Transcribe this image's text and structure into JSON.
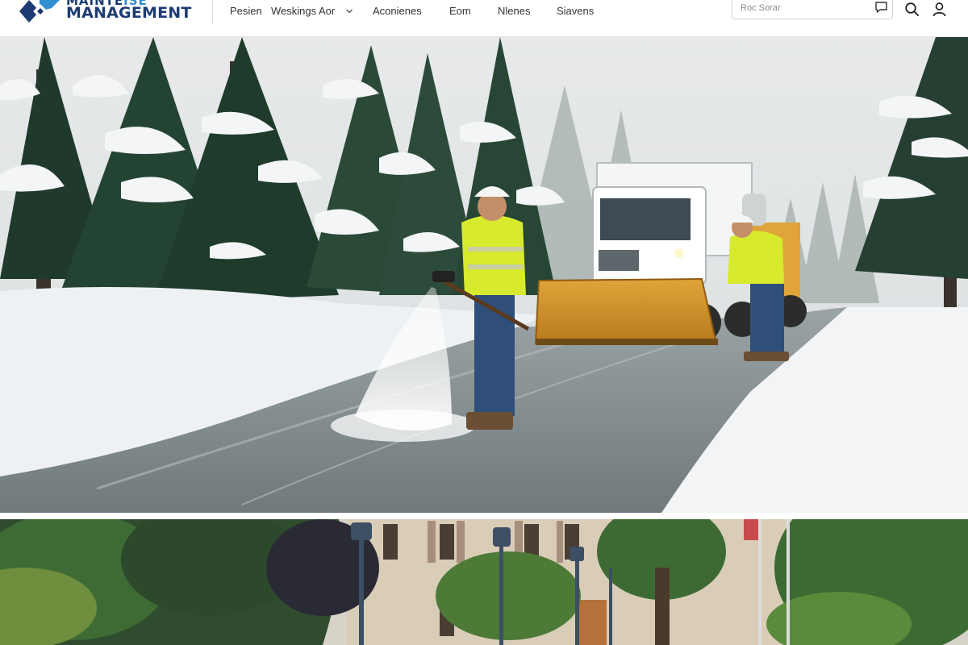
{
  "brand": {
    "name_top": "MAINTE",
    "name_top_accent": "ISE",
    "name_bottom": "MANAGEMENT",
    "colors": {
      "navy": "#1d3b73",
      "blue": "#2f8fd0"
    }
  },
  "nav": {
    "items": [
      {
        "label": "Pesien"
      },
      {
        "label": "Weskings Aor",
        "has_dropdown": true
      },
      {
        "label": "Aconienes"
      },
      {
        "label": "Eom"
      },
      {
        "label": "Nlenes"
      },
      {
        "label": "Siavens"
      }
    ]
  },
  "search": {
    "placeholder": "Roc Sorar"
  },
  "icons": {
    "chat": "chat-icon",
    "search": "search-icon",
    "user": "user-icon",
    "dropdown": "chevron-down-icon"
  },
  "hero": {
    "subject": "winter-road-maintenance-photo"
  },
  "campus": {
    "subject": "campus-grounds-photo"
  }
}
